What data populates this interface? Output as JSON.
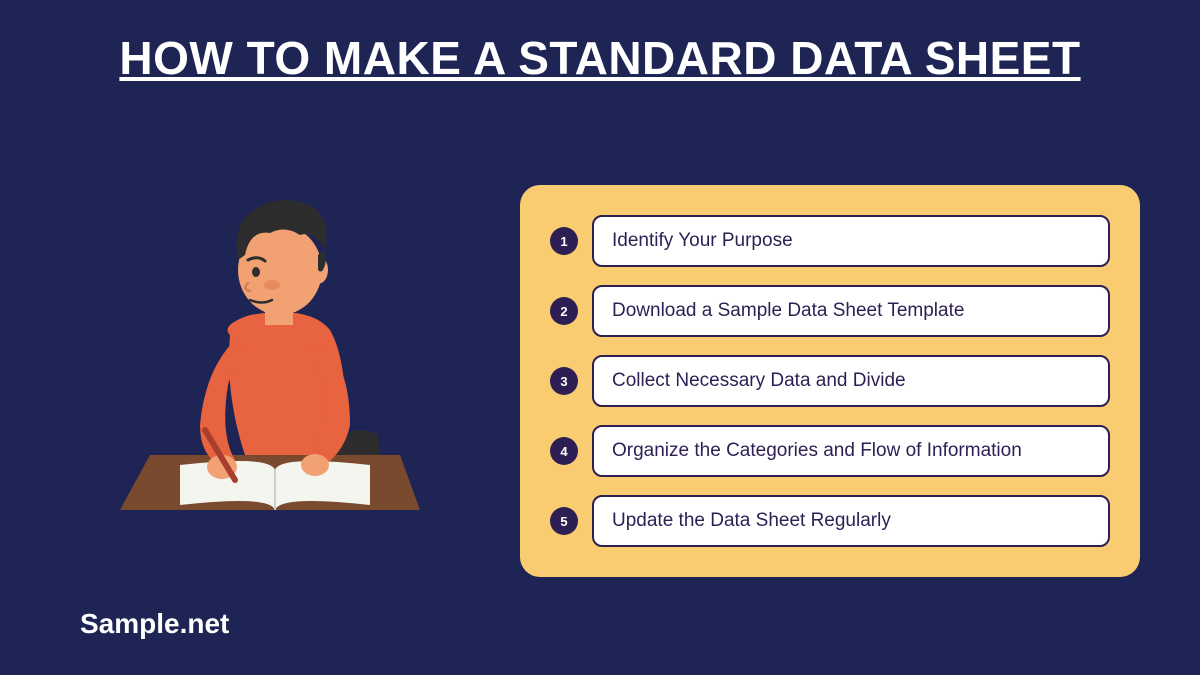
{
  "title": "HOW TO MAKE A STANDARD DATA SHEET",
  "steps": [
    {
      "num": "1",
      "text": "Identify Your Purpose"
    },
    {
      "num": "2",
      "text": "Download a Sample Data Sheet Template"
    },
    {
      "num": "3",
      "text": "Collect Necessary Data and Divide"
    },
    {
      "num": "4",
      "text": "Organize the Categories and Flow of Information"
    },
    {
      "num": "5",
      "text": "Update the Data Sheet Regularly"
    }
  ],
  "attribution": "Sample.net"
}
